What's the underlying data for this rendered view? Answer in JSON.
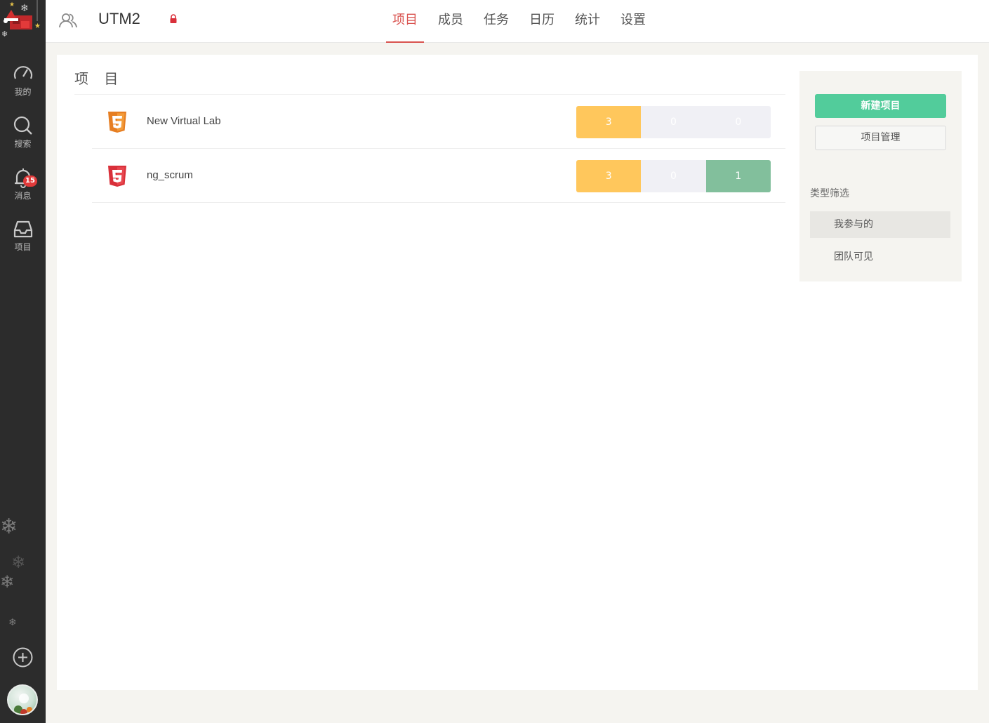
{
  "header": {
    "team_name": "UTM2",
    "tabs": [
      {
        "label": "项目",
        "active": true
      },
      {
        "label": "成员",
        "active": false
      },
      {
        "label": "任务",
        "active": false
      },
      {
        "label": "日历",
        "active": false
      },
      {
        "label": "统计",
        "active": false
      },
      {
        "label": "设置",
        "active": false
      }
    ]
  },
  "sidebar": {
    "items": [
      {
        "label": "我的",
        "icon": "dashboard-icon"
      },
      {
        "label": "搜索",
        "icon": "search-icon"
      },
      {
        "label": "消息",
        "icon": "bell-icon",
        "badge": "15"
      },
      {
        "label": "项目",
        "icon": "inbox-icon"
      }
    ]
  },
  "main": {
    "title": "项 目",
    "projects": [
      {
        "name": "New Virtual Lab",
        "icon": "html5-icon",
        "icon_color": "#e67e22",
        "stats": [
          "3",
          "0",
          "0"
        ]
      },
      {
        "name": "ng_scrum",
        "icon": "html5-icon",
        "icon_color": "#d9303a",
        "stats": [
          "3",
          "0",
          "1"
        ]
      }
    ]
  },
  "right_panel": {
    "new_button": "新建项目",
    "manage_button": "项目管理",
    "filter_title": "类型筛选",
    "filters": [
      {
        "label": "我参与的",
        "active": true
      },
      {
        "label": "团队可见",
        "active": false
      }
    ]
  },
  "colors": {
    "accent": "#d9534f",
    "primary_button": "#52cc9b",
    "stat_yellow": "#ffc75c",
    "stat_grey": "#f0f0f5",
    "stat_green": "#82bf9c",
    "sidebar_bg": "#2c2c2c"
  }
}
